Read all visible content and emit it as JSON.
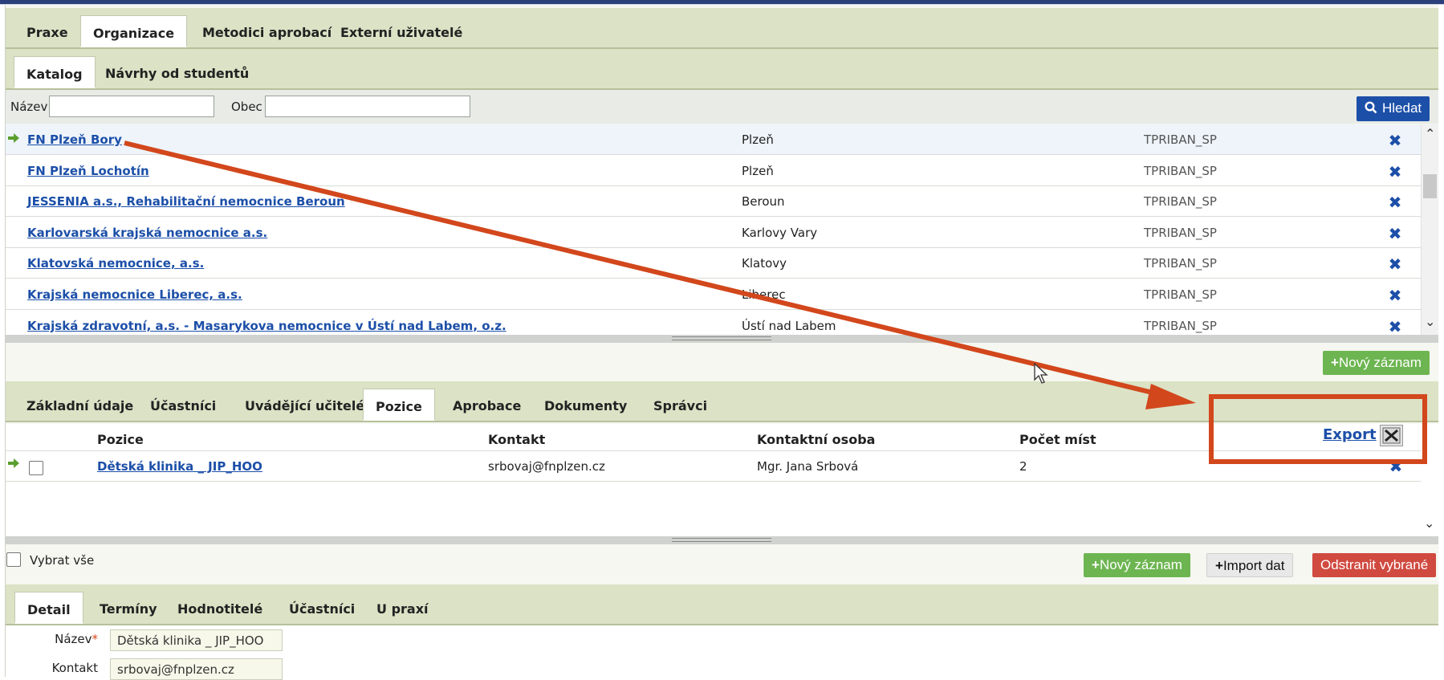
{
  "main_tabs": [
    "Praxe",
    "Organizace",
    "Metodici aprobací",
    "Externí uživatelé"
  ],
  "main_active": "Organizace",
  "sub_tabs": [
    "Katalog",
    "Návrhy od studentů"
  ],
  "sub_active": "Katalog",
  "filter": {
    "name_label": "Název",
    "name_value": "",
    "city_label": "Obec",
    "city_value": "",
    "search_button": "Hledat"
  },
  "organizations": [
    {
      "name": "FN Plzeň Bory",
      "city": "Plzeň",
      "owner": "TPRIBAN_SP",
      "selected": true
    },
    {
      "name": "FN Plzeň Lochotín",
      "city": "Plzeň",
      "owner": "TPRIBAN_SP"
    },
    {
      "name": "JESSENIA a.s., Rehabilitační nemocnice Beroun",
      "city": "Beroun",
      "owner": "TPRIBAN_SP"
    },
    {
      "name": "Karlovarská krajská nemocnice a.s.",
      "city": "Karlovy Vary",
      "owner": "TPRIBAN_SP"
    },
    {
      "name": "Klatovská nemocnice, a.s.",
      "city": "Klatovy",
      "owner": "TPRIBAN_SP"
    },
    {
      "name": "Krajská nemocnice Liberec, a.s.",
      "city": "Liberec",
      "owner": "TPRIBAN_SP"
    },
    {
      "name": "Krajská zdravotní, a.s. - Masarykova nemocnice v Ústí nad Labem, o.z.",
      "city": "Ústí nad Labem",
      "owner": "TPRIBAN_SP"
    }
  ],
  "new_record_label": "Nový záznam",
  "detail_tabs": [
    "Základní údaje",
    "Účastníci",
    "Uvádějící učitelé",
    "Pozice",
    "Aprobace",
    "Dokumenty",
    "Správci"
  ],
  "detail_active": "Pozice",
  "positions_header": {
    "position": "Pozice",
    "contact": "Kontakt",
    "contact_person": "Kontaktní osoba",
    "seats": "Počet míst",
    "export": "Export"
  },
  "positions": [
    {
      "position": "Dětská klinika _ JIP_HOO",
      "contact": "srbovaj@fnplzen.cz",
      "contact_person": "Mgr. Jana Srbová",
      "seats": "2"
    }
  ],
  "select_all_label": "Vybrat vše",
  "actions": {
    "new_record": "Nový záznam",
    "import": "Import dat",
    "delete_selected": "Odstranit vybrané"
  },
  "bottom_tabs": [
    "Detail",
    "Termíny",
    "Hodnotitelé",
    "Účastníci",
    "U praxí"
  ],
  "bottom_active": "Detail",
  "detail_form": {
    "name_label": "Název",
    "required_mark": "*",
    "name_value": "Dětská klinika _ JIP_HOO",
    "contact_label": "Kontakt",
    "contact_value": "srbovaj@fnplzen.cz"
  },
  "colors": {
    "accent_blue": "#1c4fa8",
    "annotation_red": "#d2471c",
    "tab_bar": "#dbe2c5",
    "success_green": "#6db551",
    "danger_red": "#d04a40"
  }
}
